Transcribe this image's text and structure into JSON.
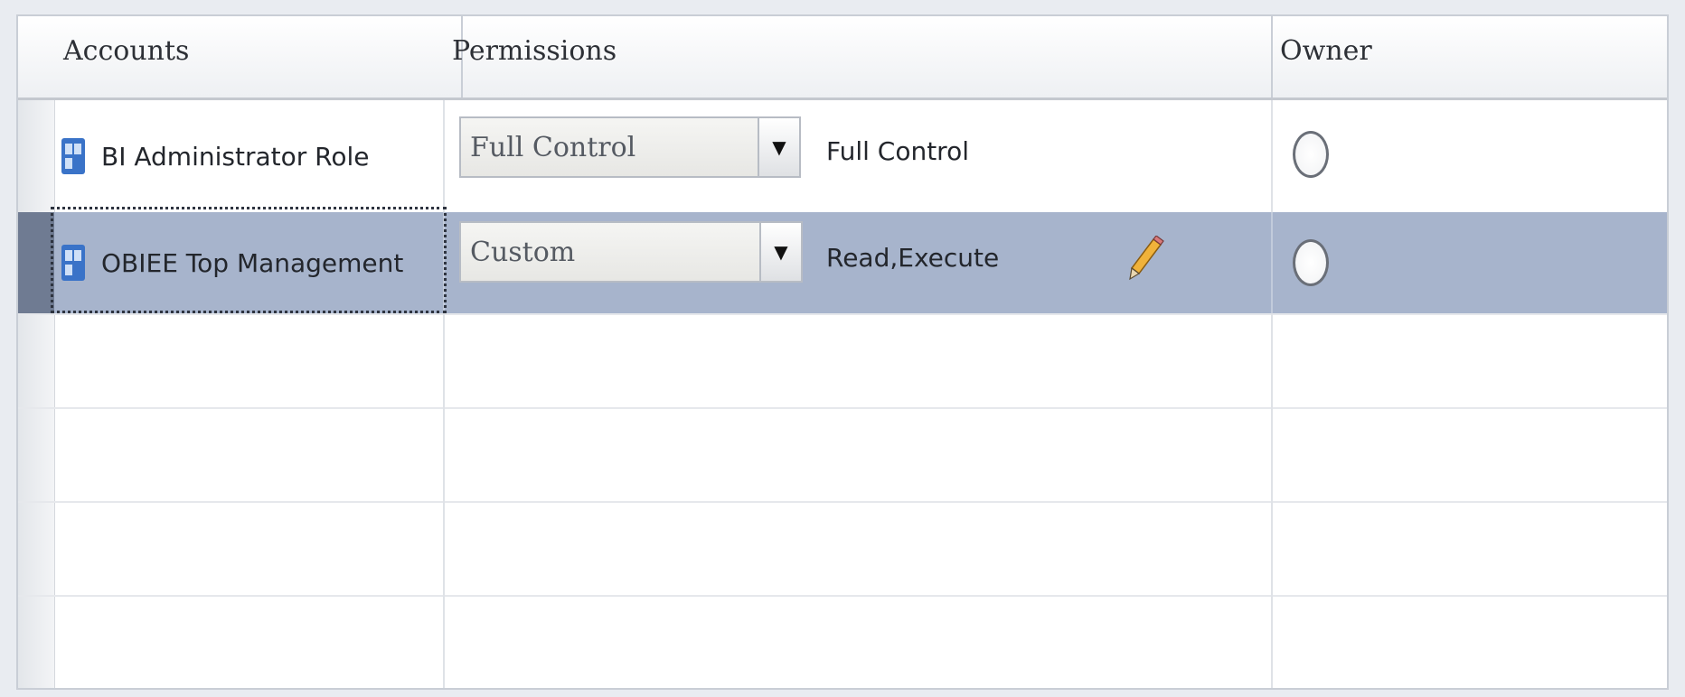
{
  "columns": {
    "accounts": "Accounts",
    "permissions": "Permissions",
    "owner": "Owner"
  },
  "rows": [
    {
      "account": "BI Administrator Role",
      "account_icon": "role-icon",
      "permission_select": "Full Control",
      "permission_detail": "Full Control",
      "owner_selected": false,
      "selected": false
    },
    {
      "account": "OBIEE Top Management",
      "account_icon": "role-icon",
      "permission_select": "Custom",
      "permission_detail": "Read,Execute",
      "has_edit_icon": true,
      "owner_selected": false,
      "selected": true
    }
  ],
  "colors": {
    "selected_row": "#a7b4cc",
    "role_icon": "#3a73c8"
  }
}
